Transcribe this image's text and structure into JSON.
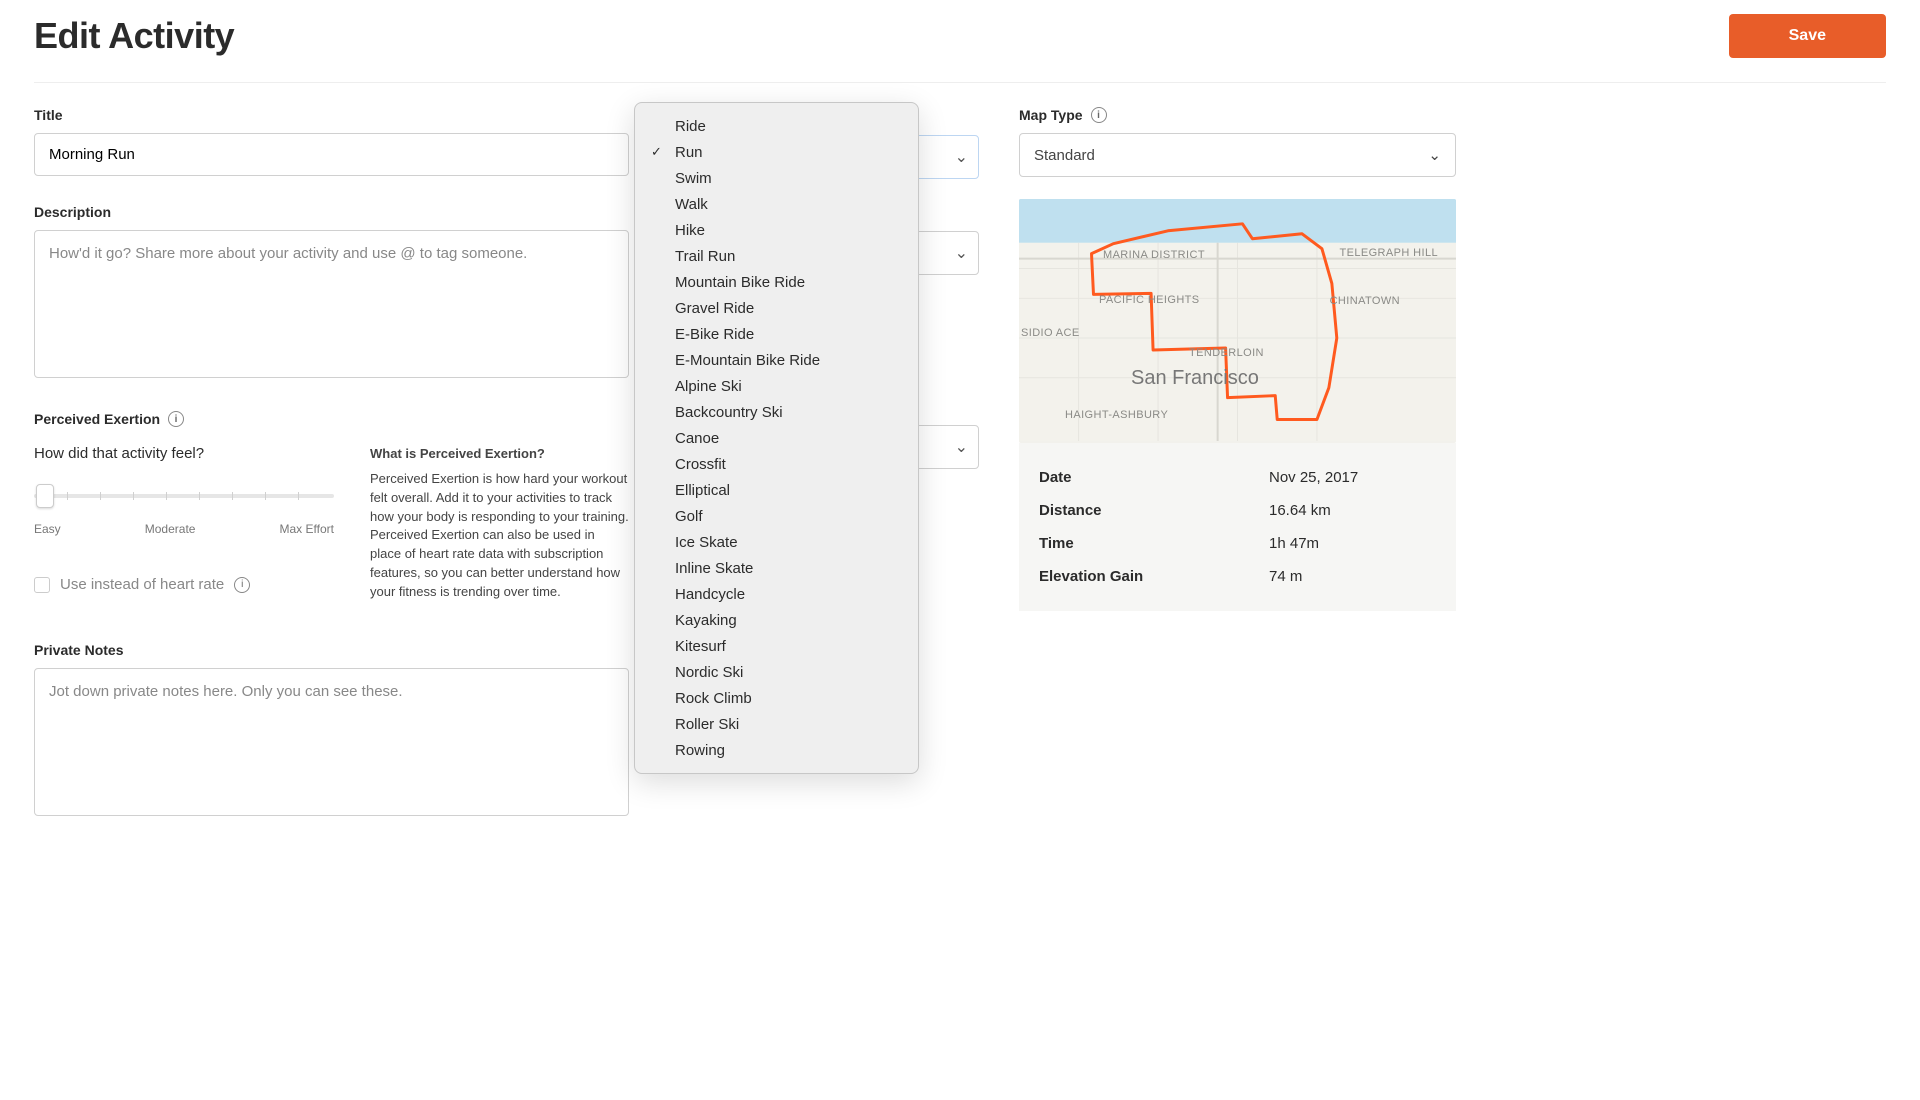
{
  "header": {
    "title": "Edit Activity",
    "save_label": "Save"
  },
  "left": {
    "title_label": "Title",
    "title_value": "Morning Run",
    "description_label": "Description",
    "description_placeholder": "How'd it go? Share more about your activity and use @ to tag someone.",
    "pe_label": "Perceived Exertion",
    "pe_question": "How did that activity feel?",
    "pe_scale": {
      "min": "Easy",
      "mid": "Moderate",
      "max": "Max Effort"
    },
    "pe_checkbox_label": "Use instead of heart rate",
    "pe_help_title": "What is Perceived Exertion?",
    "pe_help_body": "Perceived Exertion is how hard your workout felt overall. Add it to your activities to track how your body is responding to your training. Perceived Exertion can also be used in place of heart rate data with subscription features, so you can better understand how your fitness is trending over time.",
    "private_label": "Private Notes",
    "private_placeholder": "Jot down private notes here. Only you can see these."
  },
  "mid": {
    "sport_selected": "Run",
    "sport_options": [
      "Ride",
      "Run",
      "Swim",
      "Walk",
      "Hike",
      "Trail Run",
      "Mountain Bike Ride",
      "Gravel Ride",
      "E-Bike Ride",
      "E-Mountain Bike Ride",
      "Alpine Ski",
      "Backcountry Ski",
      "Canoe",
      "Crossfit",
      "Elliptical",
      "Golf",
      "Ice Skate",
      "Inline Skate",
      "Handcycle",
      "Kayaking",
      "Kitesurf",
      "Nordic Ski",
      "Rock Climb",
      "Roller Ski",
      "Rowing"
    ]
  },
  "right": {
    "map_type_label": "Map Type",
    "map_type_value": "Standard",
    "map": {
      "city": "San Francisco",
      "neighborhoods": [
        "MARINA DISTRICT",
        "TELEGRAPH HILL",
        "PACIFIC HEIGHTS",
        "CHINATOWN",
        "TENDERLOIN",
        "HAIGHT-ASHBURY"
      ],
      "partial_label": "SIDIO ACE"
    },
    "stats": {
      "date_label": "Date",
      "date_value": "Nov 25, 2017",
      "distance_label": "Distance",
      "distance_value": "16.64 km",
      "time_label": "Time",
      "time_value": "1h 47m",
      "elev_label": "Elevation Gain",
      "elev_value": "74 m"
    }
  }
}
